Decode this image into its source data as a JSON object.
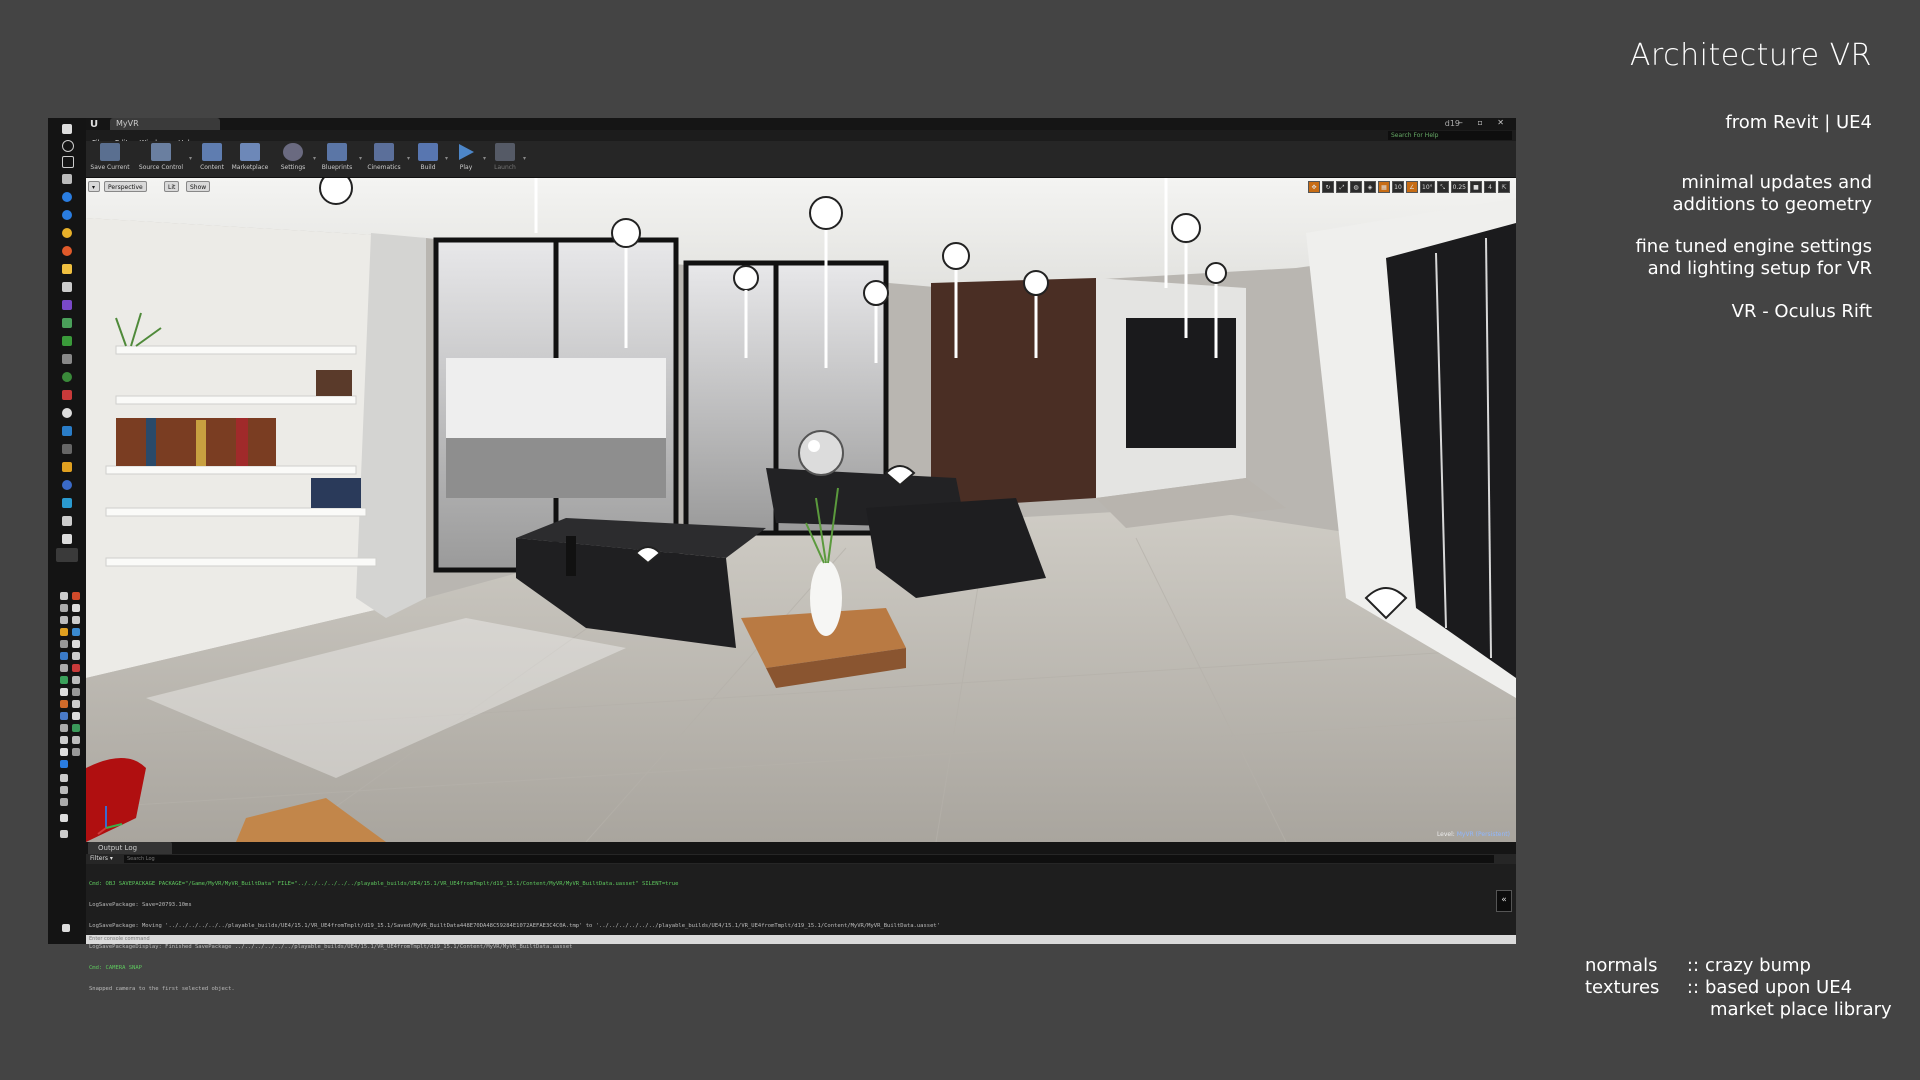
{
  "slide": {
    "title": "Architecture VR",
    "source_line": "from Revit   |   UE4",
    "notes": [
      [
        "minimal updates and",
        "additions to geometry"
      ],
      [
        "fine tuned engine settings",
        "and lighting setup for VR"
      ],
      [
        "VR - Oculus Rift"
      ]
    ],
    "credits": [
      {
        "key": "normals",
        "sep": "::",
        "value": "crazy bump"
      },
      {
        "key": "textures",
        "sep": "::",
        "value": "based upon UE4"
      },
      {
        "key": "",
        "sep": "",
        "value": "market place library"
      }
    ]
  },
  "editor": {
    "tab_label": "MyVR",
    "project_name": "d19",
    "search_help_placeholder": "Search For Help",
    "window_buttons": "‒ ▫ ✕",
    "menu": [
      "File",
      "Edit",
      "Window",
      "Help"
    ],
    "toolbar": [
      {
        "label": "Save Current",
        "icon": "save-icon",
        "color": "#5a6f90"
      },
      {
        "label": "Source Control",
        "icon": "source-control-icon",
        "color": "#6a7fa0"
      },
      {
        "label": "Content",
        "icon": "content-icon",
        "color": "#5f7db0"
      },
      {
        "label": "Marketplace",
        "icon": "marketplace-icon",
        "color": "#6d88b8"
      },
      {
        "label": "Settings",
        "icon": "settings-icon",
        "color": "#6a6a80"
      },
      {
        "label": "Blueprints",
        "icon": "blueprints-icon",
        "color": "#5b76a6"
      },
      {
        "label": "Cinematics",
        "icon": "cinematics-icon",
        "color": "#5b6f9a"
      },
      {
        "label": "Build",
        "icon": "build-icon",
        "color": "#5876b0"
      },
      {
        "label": "Play",
        "icon": "play-icon",
        "color": "#4d86c8"
      },
      {
        "label": "Launch",
        "icon": "launch-icon",
        "color": "#555a66"
      }
    ],
    "viewport": {
      "view_mode": "Perspective",
      "lighting_mode": "Lit",
      "show_label": "Show",
      "grid_snap": "10",
      "rotation_snap": "10°",
      "scale_snap": "0.25",
      "camera_speed": "4",
      "level_label": "Level:",
      "level_value": "MyVR (Persistent)"
    },
    "output_log": {
      "tab_label": "Output Log",
      "filters_label": "Filters ▾",
      "search_placeholder": "Search Log",
      "lines": [
        {
          "text": "Cmd: OBJ SAVEPACKAGE PACKAGE=\"/Game/MyVR/MyVR_BuiltData\" FILE=\"../../../../../../playable_builds/UE4/15.1/VR_UE4fromTmplt/d19_15.1/Content/MyVR/MyVR_BuiltData.uasset\" SILENT=true",
          "color": "green"
        },
        {
          "text": "LogSavePackage: Save=20793.10ms",
          "color": "grey"
        },
        {
          "text": "LogSavePackage: Moving '../../../../../../playable_builds/UE4/15.1/VR_UE4fromTmplt/d19_15.1/Saved/MyVR_BuiltData448E70DA48C59284E1072AEFAE3C4C0A.tmp' to '../../../../../../playable_builds/UE4/15.1/VR_UE4fromTmplt/d19_15.1/Content/MyVR/MyVR_BuiltData.uasset'",
          "color": "grey"
        },
        {
          "text": "LogSavePackageDisplay: Finished SavePackage ../../../../../../playable_builds/UE4/15.1/VR_UE4fromTmplt/d19_15.1/Content/MyVR/MyVR_BuiltData.uasset",
          "color": "grey"
        },
        {
          "text": "Cmd: CAMERA SNAP",
          "color": "green"
        },
        {
          "text": "Snapped camera to the first selected object.",
          "color": "grey"
        }
      ],
      "console_placeholder": "Enter console command"
    }
  }
}
